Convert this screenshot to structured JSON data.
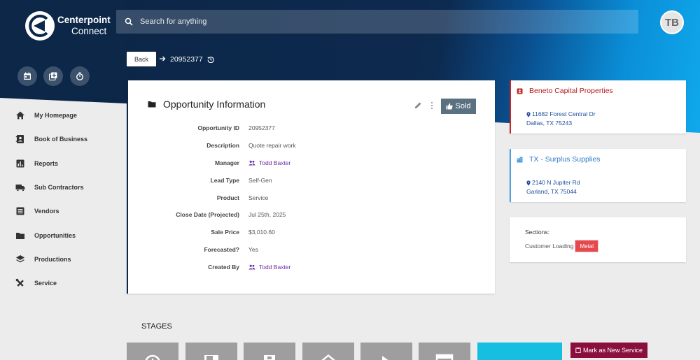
{
  "app": {
    "logo_line1": "Centerpoint",
    "logo_line2": "Connect"
  },
  "search": {
    "placeholder": "Search for anything"
  },
  "user": {
    "initials": "TB"
  },
  "quick_actions": [
    {
      "icon": "calendar-icon"
    },
    {
      "icon": "add-note-icon"
    },
    {
      "icon": "timer-icon"
    }
  ],
  "sidebar": {
    "items": [
      {
        "label": "My Homepage",
        "icon": "home-icon"
      },
      {
        "label": "Book of Business",
        "icon": "contacts-book-icon"
      },
      {
        "label": "Reports",
        "icon": "bar-chart-icon"
      },
      {
        "label": "Sub Contractors",
        "icon": "truck-icon"
      },
      {
        "label": "Vendors",
        "icon": "list-icon"
      },
      {
        "label": "Opportunities",
        "icon": "folder-icon"
      },
      {
        "label": "Productions",
        "icon": "layers-icon"
      },
      {
        "label": "Service",
        "icon": "tools-icon"
      }
    ]
  },
  "breadcrumb": {
    "back_label": "Back",
    "record_id": "20952377"
  },
  "opportunity": {
    "title": "Opportunity Information",
    "status_label": "Sold",
    "fields": [
      {
        "label": "Opportunity ID",
        "value": "20952377",
        "link": false
      },
      {
        "label": "Description",
        "value": "Quote repair work",
        "link": false
      },
      {
        "label": "Manager",
        "value": "Todd Baxter",
        "link": true
      },
      {
        "label": "Lead Type",
        "value": "Self-Gen",
        "link": false
      },
      {
        "label": "Product",
        "value": "Service",
        "link": false
      },
      {
        "label": "Close Date (Projected)",
        "value": "Jul 25th, 2025",
        "link": false
      },
      {
        "label": "Sale Price",
        "value": "$3,010.60",
        "link": false
      },
      {
        "label": "Forecasted?",
        "value": "Yes",
        "link": false
      },
      {
        "label": "Created By",
        "value": "Todd Baxter",
        "link": true
      }
    ]
  },
  "customer": {
    "name": "Beneto Capital Properties",
    "address_line1": "11682 Forest Central Dr",
    "address_line2": "Dallas, TX 75243"
  },
  "branch": {
    "name": "TX - Surplus Supplies",
    "address_line1": "2140 N Jupiter Rd",
    "address_line2": "Garland, TX 75044"
  },
  "sections": {
    "label": "Sections:",
    "item": "Customer Loading",
    "tag": "Metal"
  },
  "stages": {
    "title": "STAGES",
    "mark_new_label": "Mark as New Service"
  },
  "colors": {
    "header_dark": "#0c2748",
    "accent_blue": "#10a8ec",
    "sold_button": "#5a7180",
    "customer_red": "#b71c1c",
    "branch_blue": "#2e7bc4",
    "tag_red": "#e5484d",
    "mark_button": "#8b0f3c",
    "stage_active": "#16bfe0",
    "link_purple": "#6a2aa5"
  }
}
